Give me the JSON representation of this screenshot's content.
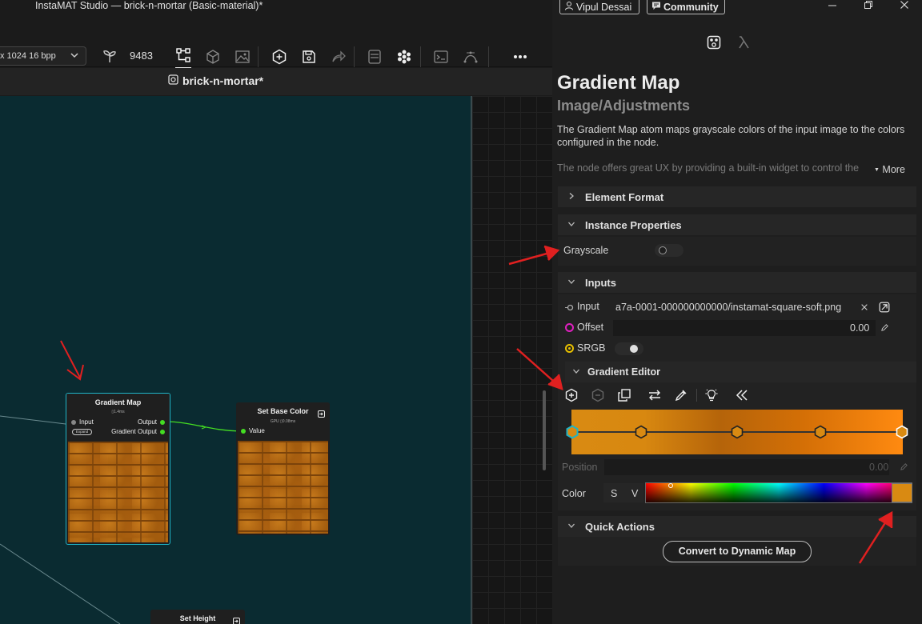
{
  "app": {
    "title": "InstaMAT Studio — brick-n-mortar (Basic-material)*",
    "tab_title": "brick-n-mortar*"
  },
  "toolbar": {
    "resolution": "x 1024 16 bpp",
    "seed": "9483"
  },
  "header": {
    "user": "Vipul Dessai",
    "community": "Community"
  },
  "nodes": {
    "gradient_map": {
      "title": "Gradient Map",
      "timing": "▯1.4ms",
      "port_input": "Input",
      "port_output": "Output",
      "port_gradient_output": "Gradient Output",
      "expand": "Expand"
    },
    "set_base_color": {
      "title": "Set Base Color",
      "timing": "GPU ▯0.08ms",
      "port_value": "Value"
    },
    "set_height": {
      "title": "Set Height"
    }
  },
  "panel": {
    "title": "Gradient Map",
    "subtitle": "Image/Adjustments",
    "description": "The Gradient Map atom maps grayscale colors of the input image to the colors configured in the node.",
    "description_more": "The node offers great UX by providing a built-in widget to control the",
    "more": "More",
    "sections": {
      "element_format": "Element Format",
      "instance_properties": "Instance Properties",
      "inputs": "Inputs",
      "gradient_editor": "Gradient Editor",
      "quick_actions": "Quick Actions"
    },
    "grayscale_label": "Grayscale",
    "inputs": {
      "input_label": "Input",
      "input_value": "a7a-0001-000000000000/instamat-square-soft.png",
      "offset_label": "Offset",
      "offset_value": "0.00",
      "srgb_label": "SRGB"
    },
    "gradient": {
      "position_label": "Position",
      "position_value": "0.00",
      "color_label": "Color",
      "s_label": "S",
      "v_label": "V",
      "stop_color": "#d98a12",
      "stops": [
        0.0,
        0.21,
        0.5,
        0.75,
        1.0
      ]
    },
    "convert_button": "Convert to Dynamic Map"
  },
  "colors": {
    "canvas_bg": "#0a2b31",
    "accent_cyan": "#1fb4c7",
    "annotation_red": "#e02020",
    "port_green": "#44dd22",
    "offset_magenta": "#e020c0",
    "srgb_yellow": "#e8c000"
  }
}
